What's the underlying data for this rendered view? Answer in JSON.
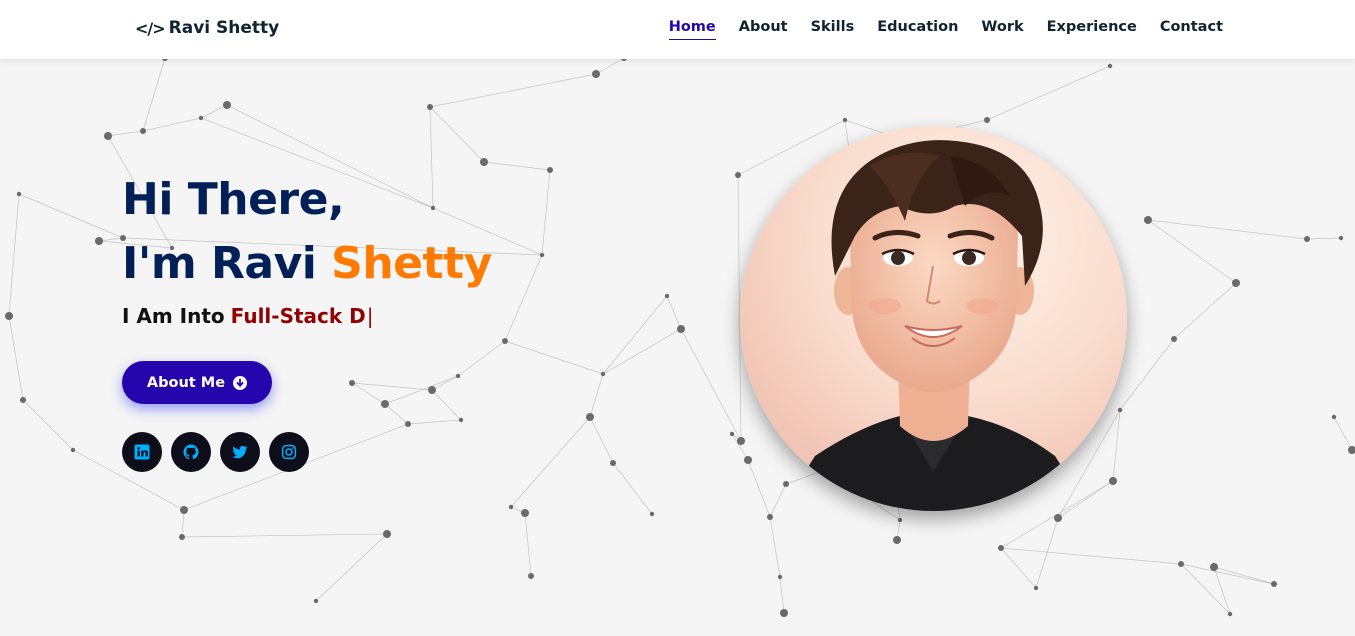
{
  "header": {
    "logo_icon": "</>",
    "logo_text": "Ravi Shetty",
    "nav": [
      {
        "label": "Home",
        "active": true
      },
      {
        "label": "About",
        "active": false
      },
      {
        "label": "Skills",
        "active": false
      },
      {
        "label": "Education",
        "active": false
      },
      {
        "label": "Work",
        "active": false
      },
      {
        "label": "Experience",
        "active": false
      },
      {
        "label": "Contact",
        "active": false
      }
    ]
  },
  "hero": {
    "greeting": "Hi There,",
    "intro": "I'm Ravi",
    "name_accent": "Shetty",
    "typing_prefix": "I Am Into",
    "typing_text": "Full-Stack D",
    "cursor": "|",
    "button_label": "About Me",
    "button_icon": "arrow-down-circle-icon"
  },
  "socials": [
    {
      "name": "linkedin-icon"
    },
    {
      "name": "github-icon"
    },
    {
      "name": "twitter-icon"
    },
    {
      "name": "instagram-icon"
    }
  ],
  "colors": {
    "primary": "#2506ad",
    "heading": "#002057",
    "accent": "#ff7a00",
    "typing": "#920000",
    "social_icon": "#00aeff",
    "background": "#f5f5f5"
  }
}
